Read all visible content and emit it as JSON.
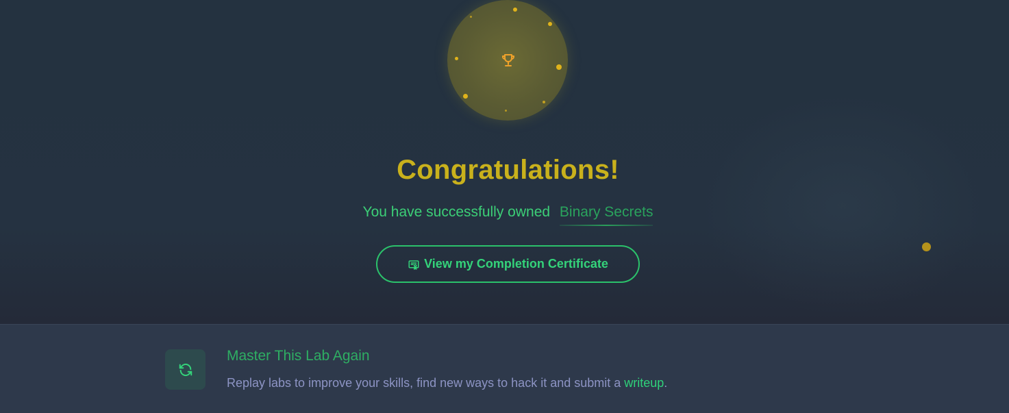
{
  "hero": {
    "title": "Congratulations!",
    "subtitle_prefix": "You have successfully owned",
    "lab_name": "Binary Secrets",
    "certificate_button_label": "View my Completion Certificate",
    "trophy_icon": "trophy-icon",
    "certificate_icon": "certificate-icon"
  },
  "replay": {
    "icon": "refresh-icon",
    "title": "Master This Lab Again",
    "description_prefix": "Replay labs to improve your skills, find new ways to hack it and submit a ",
    "link_label": "writeup",
    "description_suffix": "."
  },
  "colors": {
    "accent_green": "#2fd27a",
    "title_gold": "#c9b11c",
    "background": "#253241",
    "panel": "#2e394b"
  }
}
